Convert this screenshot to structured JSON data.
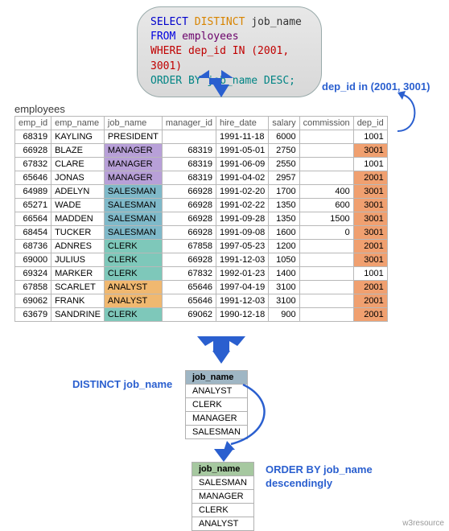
{
  "sql": {
    "select": "SELECT",
    "distinct": "DISTINCT",
    "jobname": "job_name",
    "from": "FROM",
    "employees": "employees",
    "where": "WHERE dep_id IN (2001, 3001)",
    "orderby": "ORDER BY job_name DESC;"
  },
  "annotations": {
    "dep_in": "dep_id in (2001, 3001)",
    "distinct_job": "DISTINCT job_name",
    "order_desc_l1": "ORDER BY job_name",
    "order_desc_l2": "descendingly",
    "table_label": "employees"
  },
  "columns": [
    "emp_id",
    "emp_name",
    "job_name",
    "manager_id",
    "hire_date",
    "salary",
    "commission",
    "dep_id"
  ],
  "rows": [
    {
      "emp_id": "68319",
      "emp_name": "KAYLING",
      "job_name": "PRESIDENT",
      "manager_id": "",
      "hire_date": "1991-11-18",
      "salary": "6000",
      "commission": "",
      "dep_id": "1001",
      "job_hl": "",
      "dep_hl": ""
    },
    {
      "emp_id": "66928",
      "emp_name": "BLAZE",
      "job_name": "MANAGER",
      "manager_id": "68319",
      "hire_date": "1991-05-01",
      "salary": "2750",
      "commission": "",
      "dep_id": "3001",
      "job_hl": "hl-purple",
      "dep_hl": "hl-salmon"
    },
    {
      "emp_id": "67832",
      "emp_name": "CLARE",
      "job_name": "MANAGER",
      "manager_id": "68319",
      "hire_date": "1991-06-09",
      "salary": "2550",
      "commission": "",
      "dep_id": "1001",
      "job_hl": "hl-purple",
      "dep_hl": ""
    },
    {
      "emp_id": "65646",
      "emp_name": "JONAS",
      "job_name": "MANAGER",
      "manager_id": "68319",
      "hire_date": "1991-04-02",
      "salary": "2957",
      "commission": "",
      "dep_id": "2001",
      "job_hl": "hl-purple",
      "dep_hl": "hl-salmon"
    },
    {
      "emp_id": "64989",
      "emp_name": "ADELYN",
      "job_name": "SALESMAN",
      "manager_id": "66928",
      "hire_date": "1991-02-20",
      "salary": "1700",
      "commission": "400",
      "dep_id": "3001",
      "job_hl": "hl-blue",
      "dep_hl": "hl-salmon"
    },
    {
      "emp_id": "65271",
      "emp_name": "WADE",
      "job_name": "SALESMAN",
      "manager_id": "66928",
      "hire_date": "1991-02-22",
      "salary": "1350",
      "commission": "600",
      "dep_id": "3001",
      "job_hl": "hl-blue",
      "dep_hl": "hl-salmon"
    },
    {
      "emp_id": "66564",
      "emp_name": "MADDEN",
      "job_name": "SALESMAN",
      "manager_id": "66928",
      "hire_date": "1991-09-28",
      "salary": "1350",
      "commission": "1500",
      "dep_id": "3001",
      "job_hl": "hl-blue",
      "dep_hl": "hl-salmon"
    },
    {
      "emp_id": "68454",
      "emp_name": "TUCKER",
      "job_name": "SALESMAN",
      "manager_id": "66928",
      "hire_date": "1991-09-08",
      "salary": "1600",
      "commission": "0",
      "dep_id": "3001",
      "job_hl": "hl-blue",
      "dep_hl": "hl-salmon"
    },
    {
      "emp_id": "68736",
      "emp_name": "ADNRES",
      "job_name": "CLERK",
      "manager_id": "67858",
      "hire_date": "1997-05-23",
      "salary": "1200",
      "commission": "",
      "dep_id": "2001",
      "job_hl": "hl-teal",
      "dep_hl": "hl-salmon"
    },
    {
      "emp_id": "69000",
      "emp_name": "JULIUS",
      "job_name": "CLERK",
      "manager_id": "66928",
      "hire_date": "1991-12-03",
      "salary": "1050",
      "commission": "",
      "dep_id": "3001",
      "job_hl": "hl-teal",
      "dep_hl": "hl-salmon"
    },
    {
      "emp_id": "69324",
      "emp_name": "MARKER",
      "job_name": "CLERK",
      "manager_id": "67832",
      "hire_date": "1992-01-23",
      "salary": "1400",
      "commission": "",
      "dep_id": "1001",
      "job_hl": "hl-teal",
      "dep_hl": ""
    },
    {
      "emp_id": "67858",
      "emp_name": "SCARLET",
      "job_name": "ANALYST",
      "manager_id": "65646",
      "hire_date": "1997-04-19",
      "salary": "3100",
      "commission": "",
      "dep_id": "2001",
      "job_hl": "hl-orange",
      "dep_hl": "hl-salmon"
    },
    {
      "emp_id": "69062",
      "emp_name": "FRANK",
      "job_name": "ANALYST",
      "manager_id": "65646",
      "hire_date": "1991-12-03",
      "salary": "3100",
      "commission": "",
      "dep_id": "2001",
      "job_hl": "hl-orange",
      "dep_hl": "hl-salmon"
    },
    {
      "emp_id": "63679",
      "emp_name": "SANDRINE",
      "job_name": "CLERK",
      "manager_id": "69062",
      "hire_date": "1990-12-18",
      "salary": "900",
      "commission": "",
      "dep_id": "2001",
      "job_hl": "hl-teal",
      "dep_hl": "hl-salmon"
    }
  ],
  "distinct_table": {
    "header": "job_name",
    "rows": [
      "ANALYST",
      "CLERK",
      "MANAGER",
      "SALESMAN"
    ]
  },
  "ordered_table": {
    "header": "job_name",
    "rows": [
      "SALESMAN",
      "MANAGER",
      "CLERK",
      "ANALYST"
    ]
  },
  "watermark": "w3resource"
}
